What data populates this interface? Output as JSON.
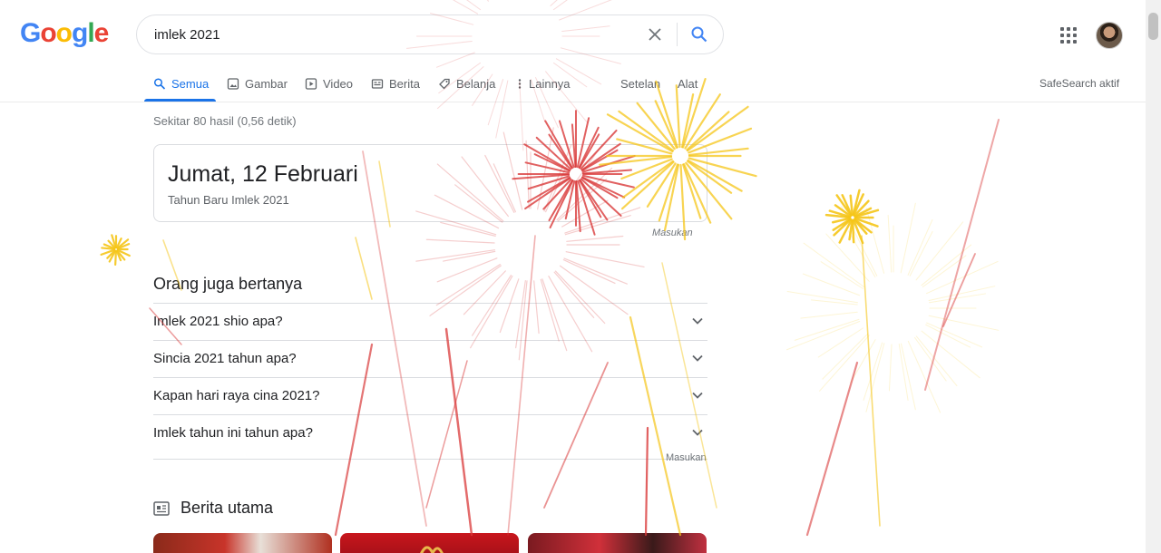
{
  "logo": {
    "letters": [
      "G",
      "o",
      "o",
      "g",
      "l",
      "e"
    ]
  },
  "search": {
    "value": "imlek 2021",
    "clear_icon": "close-icon",
    "search_icon": "search-icon"
  },
  "header": {
    "apps_icon": "apps-grid-icon",
    "avatar": "user-avatar"
  },
  "tabs": [
    {
      "label": "Semua",
      "icon": "search-icon",
      "active": true
    },
    {
      "label": "Gambar",
      "icon": "image-icon"
    },
    {
      "label": "Video",
      "icon": "video-icon"
    },
    {
      "label": "Berita",
      "icon": "news-icon"
    },
    {
      "label": "Belanja",
      "icon": "tag-icon"
    },
    {
      "label": "Lainnya",
      "icon": "more-vert-icon"
    },
    {
      "label": "Setelan"
    },
    {
      "label": "Alat"
    }
  ],
  "safesearch": "SafeSearch aktif",
  "result_stats": "Sekitar 80 hasil (0,56 detik)",
  "answer": {
    "main": "Jumat, 12 Februari",
    "sub": "Tahun Baru Imlek 2021",
    "feedback": "Masukan"
  },
  "paa": {
    "title": "Orang juga bertanya",
    "questions": [
      "Imlek 2021 shio apa?",
      "Sincia 2021 tahun apa?",
      "Kapan hari raya cina 2021?",
      "Imlek tahun ini tahun apa?"
    ],
    "feedback": "Masukan"
  },
  "news": {
    "title": "Berita utama",
    "icon": "newspaper-icon"
  },
  "colors": {
    "accent": "#1a73e8",
    "firework_red": "#d93a3a",
    "firework_gold": "#f5c518"
  }
}
